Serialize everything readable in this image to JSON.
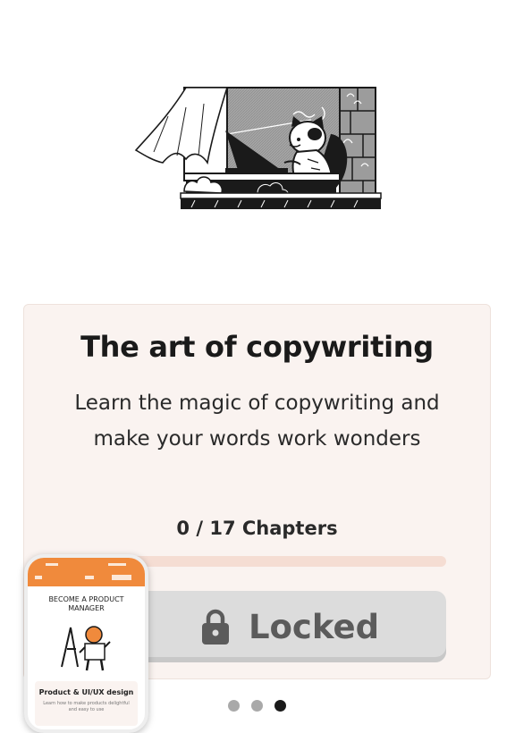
{
  "course": {
    "title": "The art of copywriting",
    "description": "Learn the magic of copywriting and make your words work wonders",
    "chapters_label": "0 / 17 Chapters",
    "chapters_completed": 0,
    "chapters_total": 17,
    "progress_fraction": 0,
    "status_label": "Locked"
  },
  "preview": {
    "heading": "BECOME A PRODUCT MANAGER",
    "card_title": "Product & UI/UX design",
    "card_description": "Learn how to make products delightful and easy to use"
  },
  "pager": {
    "total": 3,
    "active_index": 2
  },
  "icons": {
    "lock": "lock-icon"
  },
  "colors": {
    "accent": "#f08a3c",
    "card_background": "#faf3f0",
    "progress_track": "#f5ddd3",
    "locked_button": "#dcdcdc",
    "locked_text": "#5b5b5b",
    "dot_active": "#1a1a1a",
    "dot_inactive": "#a9a9a9"
  }
}
